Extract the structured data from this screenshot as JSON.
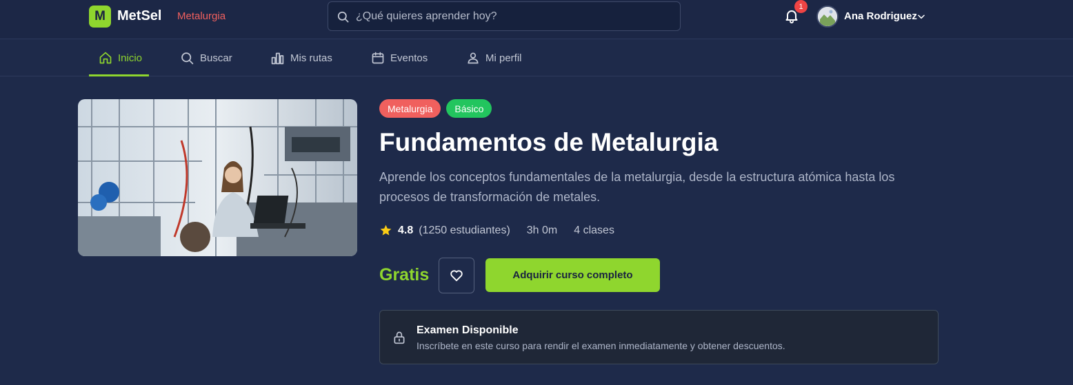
{
  "header": {
    "logo_letter": "M",
    "brand": "MetSel",
    "brand_tag": "Metalurgia",
    "search_placeholder": "¿Qué quieres aprender hoy?",
    "notification_count": "1",
    "user_name": "Ana Rodriguez"
  },
  "nav": {
    "items": [
      {
        "label": "Inicio",
        "icon": "home-icon",
        "active": true
      },
      {
        "label": "Buscar",
        "icon": "search-icon"
      },
      {
        "label": "Mis rutas",
        "icon": "chart-icon"
      },
      {
        "label": "Eventos",
        "icon": "calendar-icon"
      },
      {
        "label": "Mi perfil",
        "icon": "user-icon"
      }
    ]
  },
  "course": {
    "category": "Metalurgia",
    "level": "Básico",
    "title": "Fundamentos de Metalurgia",
    "description": "Aprende los conceptos fundamentales de la metalurgia, desde la estructura atómica hasta los procesos de transformación de metales.",
    "rating": "4.8",
    "students": "(1250 estudiantes)",
    "duration": "3h 0m",
    "classes": "4 clases",
    "price": "Gratis",
    "buy_label": "Adquirir curso completo"
  },
  "exam": {
    "title": "Examen Disponible",
    "subtitle": "Inscríbete en este curso para rendir el examen inmediatamente y obtener descuentos."
  },
  "colors": {
    "accent": "#8fd62e",
    "category": "#f0605e",
    "level": "#22c55e",
    "background": "#1e2a4a"
  }
}
